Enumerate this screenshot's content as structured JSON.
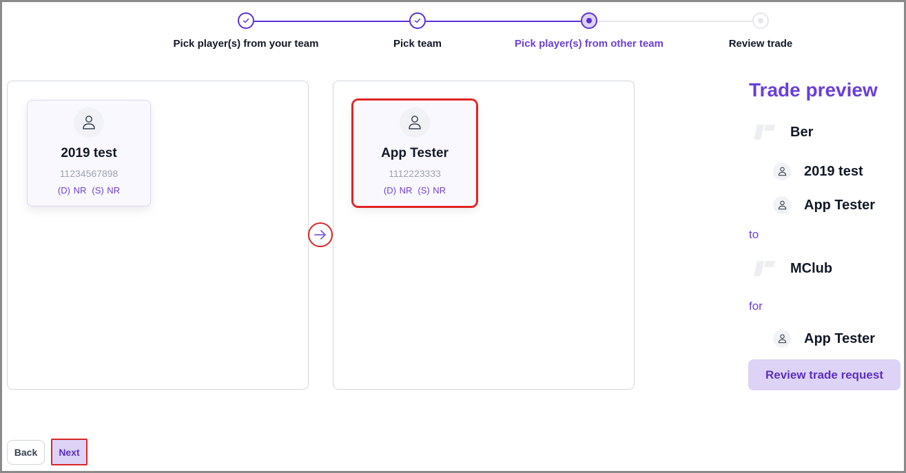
{
  "stepper": {
    "steps": [
      {
        "label": "Pick player(s) from your team",
        "state": "done"
      },
      {
        "label": "Pick team",
        "state": "done"
      },
      {
        "label": "Pick player(s) from other team",
        "state": "current"
      },
      {
        "label": "Review trade",
        "state": "todo"
      }
    ]
  },
  "your_team_panel": {
    "players": [
      {
        "name": "2019 test",
        "id": "11234567898",
        "rating_d": "(D) NR",
        "rating_s": "(S) NR",
        "selected": false
      }
    ]
  },
  "other_team_panel": {
    "players": [
      {
        "name": "App Tester",
        "id": "1112223333",
        "rating_d": "(D) NR",
        "rating_s": "(S) NR",
        "selected": true
      }
    ]
  },
  "transfer_button": {
    "icon": "arrow-right-icon"
  },
  "trade_preview": {
    "title": "Trade preview",
    "from_team": "Ber",
    "giving_players": [
      "2019 test",
      "App Tester"
    ],
    "to_label": "to",
    "to_team": "MClub",
    "for_label": "for",
    "receiving_players": [
      "App Tester"
    ],
    "review_button": "Review trade request"
  },
  "footer": {
    "back_label": "Back",
    "next_label": "Next"
  },
  "colors": {
    "accent": "#5b2fd4",
    "accent_text": "#6a3fd9",
    "accent_light": "#ddd3f6",
    "highlight_outline": "#d92525"
  }
}
